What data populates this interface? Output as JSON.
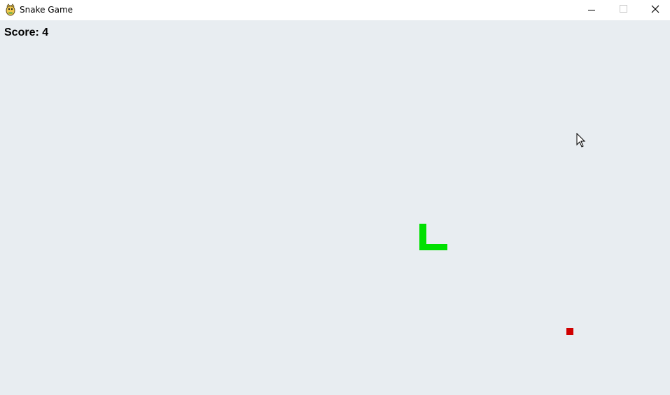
{
  "window": {
    "title": "Snake Game",
    "icons": {
      "app": "pygame-snake-icon",
      "minimize": "minimize-icon",
      "maximize": "maximize-icon",
      "close": "close-icon"
    }
  },
  "game": {
    "score_text": "Score: 4",
    "colors": {
      "background": "#e8edf1",
      "snake": "#00e000",
      "food": "#d00000"
    }
  }
}
